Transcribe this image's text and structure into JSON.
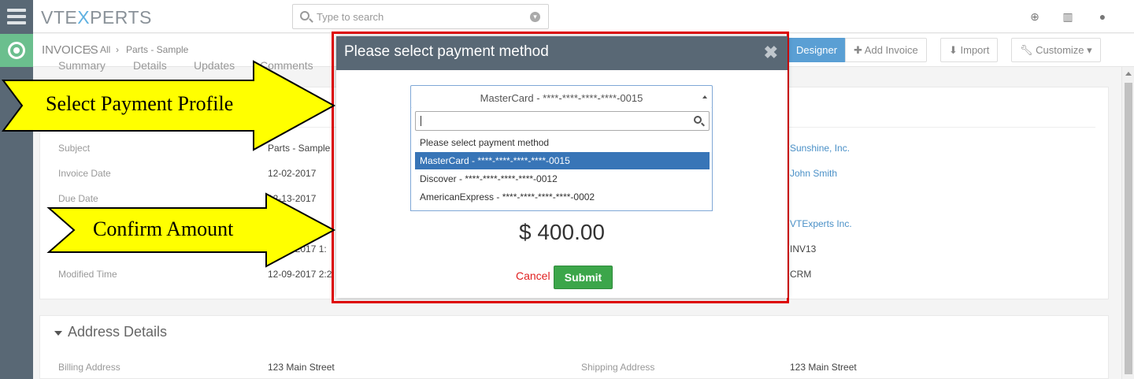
{
  "app": {
    "logo_left": "VTE",
    "logo_x": "X",
    "logo_right": "PERTS"
  },
  "search": {
    "placeholder": "Type to search"
  },
  "header": {
    "module": "INVOICES",
    "breadcrumb": [
      "All",
      "Parts - Sample"
    ],
    "buttons": {
      "designer": "Designer",
      "add_invoice": "Add Invoice",
      "import": "Import",
      "customize": "Customize"
    }
  },
  "tabs": [
    "Summary",
    "Details",
    "Updates",
    "Comments"
  ],
  "details": {
    "left_labels": [
      "Subject",
      "Invoice Date",
      "Due Date",
      "",
      "",
      "Modified Time"
    ],
    "left_values": [
      "Parts - Sample",
      "12-02-2017",
      "12-13-2017",
      "",
      "12-09-2017 1:",
      "12-09-2017 2:2"
    ],
    "right_values": [
      "Sunshine, Inc.",
      "John Smith",
      "",
      "VTExperts Inc.",
      "INV13",
      "CRM"
    ]
  },
  "address": {
    "title": "Address Details",
    "billing_label": "Billing Address",
    "billing_value": "123 Main Street",
    "shipping_label": "Shipping Address",
    "shipping_value": "123 Main Street"
  },
  "modal": {
    "title": "Please select payment method",
    "close": "✖",
    "selected": "MasterCard - ****-****-****-****-0015",
    "options": [
      "Please select payment method",
      "MasterCard - ****-****-****-****-0015",
      "Discover - ****-****-****-****-0012",
      "AmericanExpress - ****-****-****-****-0002"
    ],
    "amount": "$ 400.00",
    "cancel": "Cancel",
    "submit": "Submit"
  },
  "annotations": {
    "select_profile": "Select Payment Profile",
    "confirm_amount": "Confirm Amount"
  },
  "colors": {
    "highlight": "#e00000",
    "arrow_fill": "#ffff00",
    "submit": "#3ca64a",
    "selected_option": "#3875b7"
  }
}
